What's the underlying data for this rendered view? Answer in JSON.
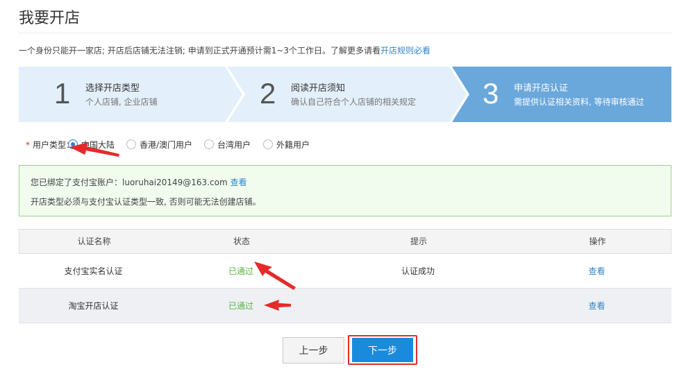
{
  "page": {
    "title": "我要开店",
    "notice_text": "一个身份只能开一家店; 开店后店铺无法注销; 申请到正式开通预计需1~3个工作日。了解更多请看",
    "notice_link": "开店规则必看"
  },
  "steps": [
    {
      "number": "1",
      "title": "选择开店类型",
      "desc": "个人店铺, 企业店铺",
      "active": false
    },
    {
      "number": "2",
      "title": "阅读开店须知",
      "desc": "确认自己符合个人店铺的相关规定",
      "active": false
    },
    {
      "number": "3",
      "title": "申请开店认证",
      "desc": "需提供认证相关资料, 等待审核通过",
      "active": true
    }
  ],
  "user_type": {
    "required_mark": "*",
    "label": "用户类型：",
    "options": [
      "中国大陆",
      "香港/澳门用户",
      "台湾用户",
      "外籍用户"
    ],
    "selected": "中国大陆"
  },
  "alipay": {
    "bound_text": "您已绑定了支付宝账户：luoruhai20149@163.com",
    "view_link": "查看",
    "warning": "开店类型必须与支付宝认证类型一致, 否则可能无法创建店铺。"
  },
  "table": {
    "headers": [
      "认证名称",
      "状态",
      "提示",
      "操作"
    ],
    "rows": [
      {
        "name": "支付宝实名认证",
        "status": "已通过",
        "hint": "认证成功",
        "action": "查看"
      },
      {
        "name": "淘宝开店认证",
        "status": "已通过",
        "hint": "",
        "action": "查看"
      }
    ]
  },
  "buttons": {
    "prev": "上一步",
    "next": "下一步"
  },
  "colors": {
    "step_inactive": "#e3effa",
    "step_active": "#6aa7db",
    "link": "#2f86cc",
    "success": "#5bb345",
    "primary_button": "#1a8bdc",
    "annotation": "#e62a2a",
    "info_border": "#9bd28a"
  }
}
